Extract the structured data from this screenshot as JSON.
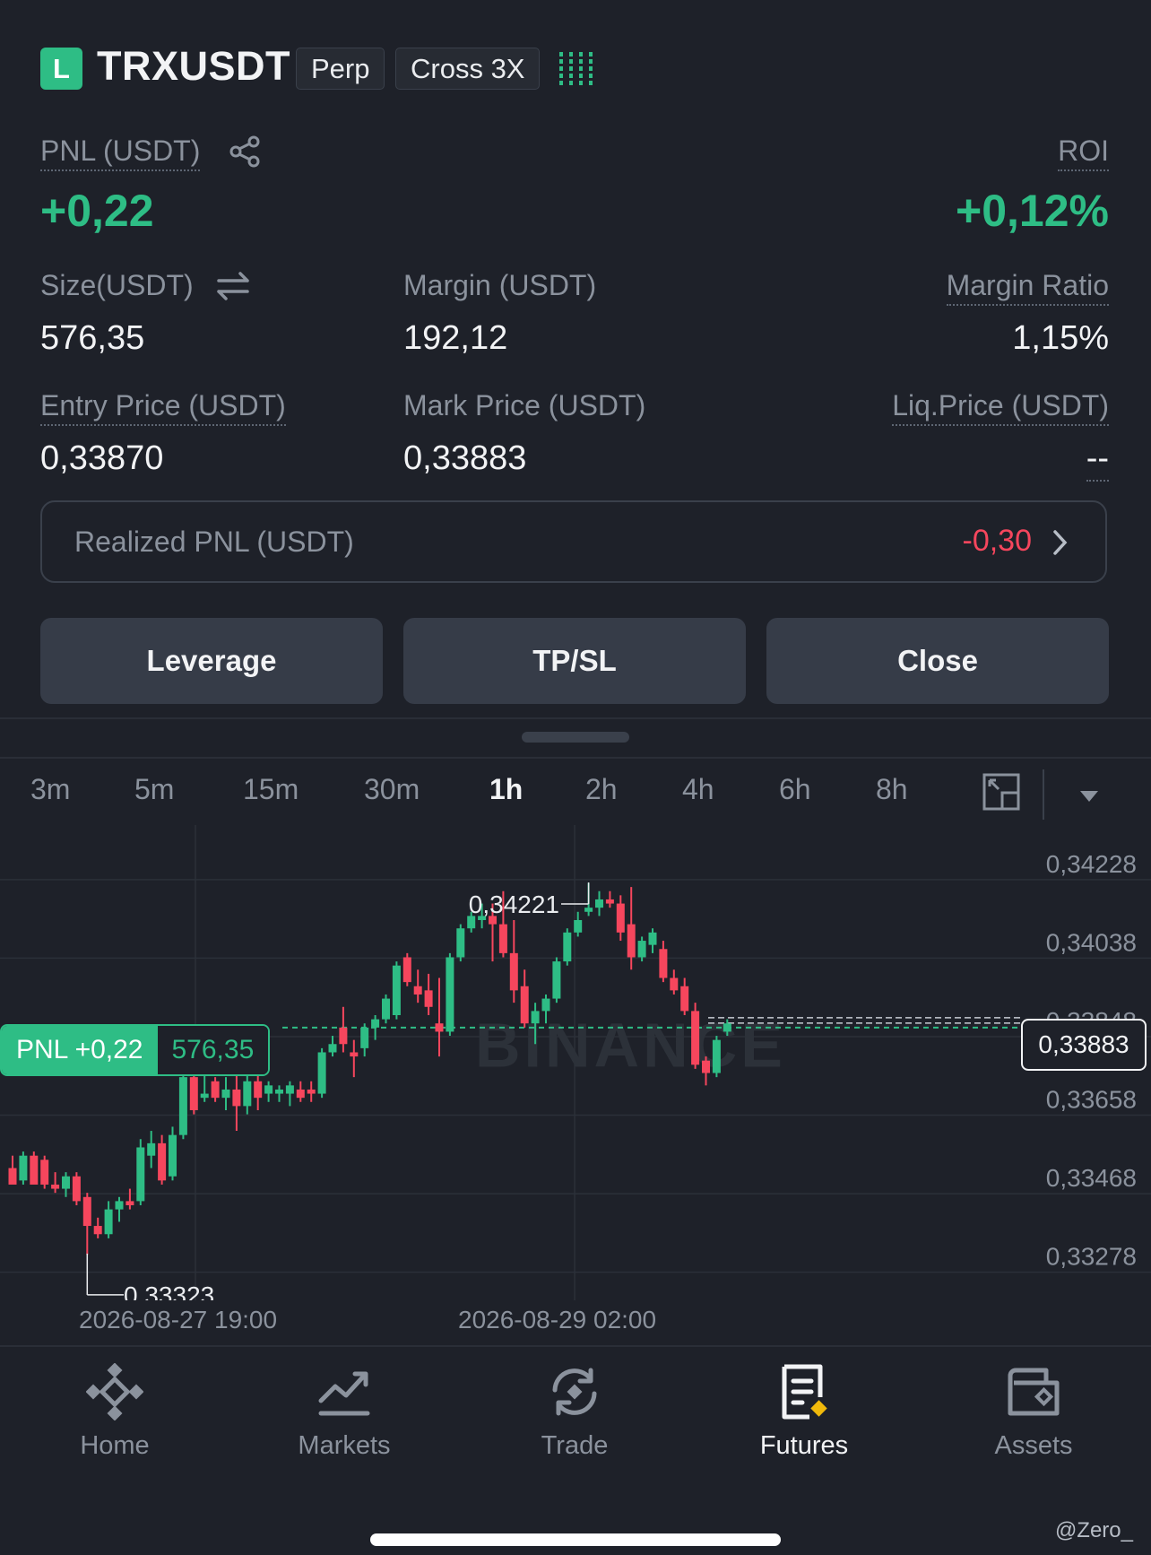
{
  "header": {
    "side_badge": "L",
    "symbol": "TRXUSDT",
    "type_tag": "Perp",
    "margin_tag": "Cross 3X"
  },
  "position": {
    "pnl_label": "PNL (USDT)",
    "pnl_value": "+0,22",
    "roi_label": "ROI",
    "roi_value": "+0,12%",
    "size_label": "Size(USDT)",
    "size_value": "576,35",
    "margin_label": "Margin (USDT)",
    "margin_value": "192,12",
    "margin_ratio_label": "Margin Ratio",
    "margin_ratio_value": "1,15%",
    "entry_label": "Entry Price (USDT)",
    "entry_value": "0,33870",
    "mark_label": "Mark Price (USDT)",
    "mark_value": "0,33883",
    "liq_label": "Liq.Price (USDT)",
    "liq_value": "--",
    "realized_label": "Realized PNL (USDT)",
    "realized_value": "-0,30"
  },
  "actions": {
    "leverage": "Leverage",
    "tpsl": "TP/SL",
    "close": "Close"
  },
  "timeframes": [
    "3m",
    "5m",
    "15m",
    "30m",
    "1h",
    "2h",
    "4h",
    "6h",
    "8h"
  ],
  "active_timeframe": "1h",
  "chart": {
    "pnl_tag": "PNL +0,22",
    "pnl_size": "576,35",
    "current_price": "0,33883",
    "high_label": "0,34221",
    "low_label": "0,33323",
    "watermark": "BINANCE"
  },
  "chart_data": {
    "type": "candlestick",
    "x_labels": [
      "2026-08-27 19:00",
      "2026-08-29 02:00"
    ],
    "y_ticks": [
      "0,34228",
      "0,34038",
      "0,33848",
      "0,33658",
      "0,33468",
      "0,33278"
    ],
    "y_tick_values": [
      0.34228,
      0.34038,
      0.33848,
      0.33658,
      0.33468,
      0.33278
    ],
    "ylim": [
      0.3321,
      0.3436
    ],
    "high": 0.34221,
    "low": 0.33323,
    "current": 0.33883,
    "up_color": "#2ebd85",
    "down_color": "#f6465d",
    "candles": [
      [
        0.3353,
        0.3356,
        0.335,
        0.3349
      ],
      [
        0.335,
        0.3357,
        0.3349,
        0.3356
      ],
      [
        0.3356,
        0.3357,
        0.335,
        0.3349
      ],
      [
        0.3355,
        0.3356,
        0.3348,
        0.3349
      ],
      [
        0.3349,
        0.3352,
        0.3347,
        0.3348
      ],
      [
        0.3348,
        0.3352,
        0.3346,
        0.3351
      ],
      [
        0.3351,
        0.3352,
        0.3344,
        0.3345
      ],
      [
        0.3346,
        0.3347,
        0.3332,
        0.3339
      ],
      [
        0.3339,
        0.3341,
        0.3336,
        0.3337
      ],
      [
        0.3337,
        0.3345,
        0.3336,
        0.3343
      ],
      [
        0.3343,
        0.3346,
        0.334,
        0.3345
      ],
      [
        0.3345,
        0.3348,
        0.3343,
        0.3344
      ],
      [
        0.3345,
        0.336,
        0.3344,
        0.3358
      ],
      [
        0.3356,
        0.3362,
        0.3353,
        0.3359
      ],
      [
        0.3359,
        0.3361,
        0.3349,
        0.335
      ],
      [
        0.3351,
        0.3363,
        0.335,
        0.3361
      ],
      [
        0.3361,
        0.3377,
        0.336,
        0.3375
      ],
      [
        0.3375,
        0.3377,
        0.3366,
        0.3367
      ],
      [
        0.337,
        0.3376,
        0.3369,
        0.3371
      ],
      [
        0.3374,
        0.3375,
        0.3369,
        0.337
      ],
      [
        0.337,
        0.3375,
        0.3367,
        0.3372
      ],
      [
        0.3372,
        0.3377,
        0.3362,
        0.3368
      ],
      [
        0.3368,
        0.3376,
        0.3366,
        0.3374
      ],
      [
        0.3374,
        0.3376,
        0.3367,
        0.337
      ],
      [
        0.3371,
        0.3374,
        0.3369,
        0.3373
      ],
      [
        0.3371,
        0.3373,
        0.3369,
        0.3372
      ],
      [
        0.3371,
        0.3374,
        0.3368,
        0.3373
      ],
      [
        0.3372,
        0.3374,
        0.3369,
        0.337
      ],
      [
        0.3372,
        0.3374,
        0.3369,
        0.3371
      ],
      [
        0.3371,
        0.3382,
        0.337,
        0.3381
      ],
      [
        0.3381,
        0.3385,
        0.338,
        0.3383
      ],
      [
        0.3387,
        0.3392,
        0.3381,
        0.3383
      ],
      [
        0.3381,
        0.3384,
        0.3375,
        0.338
      ],
      [
        0.3382,
        0.3388,
        0.338,
        0.3387
      ],
      [
        0.3387,
        0.339,
        0.3384,
        0.3389
      ],
      [
        0.3389,
        0.3395,
        0.3388,
        0.3394
      ],
      [
        0.339,
        0.3403,
        0.3389,
        0.3402
      ],
      [
        0.3404,
        0.3405,
        0.3397,
        0.3398
      ],
      [
        0.3397,
        0.3401,
        0.3393,
        0.3395
      ],
      [
        0.3396,
        0.34,
        0.339,
        0.3392
      ],
      [
        0.3388,
        0.3399,
        0.338,
        0.3386
      ],
      [
        0.3386,
        0.3405,
        0.3385,
        0.3404
      ],
      [
        0.3404,
        0.3412,
        0.3403,
        0.3411
      ],
      [
        0.3411,
        0.3415,
        0.341,
        0.3414
      ],
      [
        0.3413,
        0.3417,
        0.3411,
        0.3414
      ],
      [
        0.3414,
        0.3417,
        0.3403,
        0.3412
      ],
      [
        0.3412,
        0.342,
        0.3404,
        0.3405
      ],
      [
        0.3405,
        0.3413,
        0.3393,
        0.3396
      ],
      [
        0.3397,
        0.3401,
        0.3387,
        0.3388
      ],
      [
        0.3388,
        0.3393,
        0.3383,
        0.3391
      ],
      [
        0.3391,
        0.3395,
        0.3388,
        0.3394
      ],
      [
        0.3394,
        0.3404,
        0.3393,
        0.3403
      ],
      [
        0.3403,
        0.3411,
        0.3402,
        0.341
      ],
      [
        0.341,
        0.3415,
        0.3409,
        0.3413
      ],
      [
        0.3415,
        0.3422,
        0.3414,
        0.3416
      ],
      [
        0.3416,
        0.342,
        0.3414,
        0.3418
      ],
      [
        0.3418,
        0.342,
        0.3416,
        0.3417
      ],
      [
        0.3417,
        0.3419,
        0.3408,
        0.341
      ],
      [
        0.3412,
        0.3421,
        0.3401,
        0.3404
      ],
      [
        0.3404,
        0.3409,
        0.3403,
        0.3408
      ],
      [
        0.3407,
        0.3411,
        0.3405,
        0.341
      ],
      [
        0.3406,
        0.3408,
        0.3398,
        0.3399
      ],
      [
        0.3399,
        0.3401,
        0.3395,
        0.3396
      ],
      [
        0.3397,
        0.3399,
        0.339,
        0.3391
      ],
      [
        0.3391,
        0.3393,
        0.3377,
        0.3378
      ],
      [
        0.3379,
        0.338,
        0.3373,
        0.3376
      ],
      [
        0.3376,
        0.3385,
        0.3375,
        0.3384
      ],
      [
        0.3386,
        0.3389,
        0.3385,
        0.3388
      ]
    ]
  },
  "nav": {
    "items": [
      {
        "label": "Home",
        "icon": "binance-logo-icon"
      },
      {
        "label": "Markets",
        "icon": "chart-trend-icon"
      },
      {
        "label": "Trade",
        "icon": "trade-swap-icon"
      },
      {
        "label": "Futures",
        "icon": "futures-doc-icon"
      },
      {
        "label": "Assets",
        "icon": "wallet-icon"
      }
    ],
    "active": "Futures"
  },
  "watermark_text": "@Zero_"
}
